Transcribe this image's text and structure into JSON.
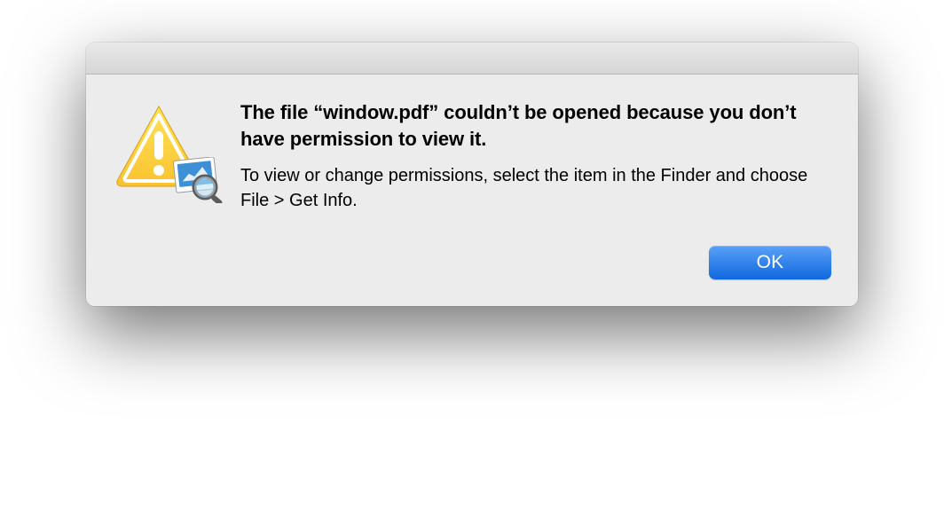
{
  "dialog": {
    "heading": "The file “window.pdf” couldn’t be opened because you don’t have permission to view it.",
    "description": "To view or change permissions, select the item in the Finder and choose File > Get Info.",
    "ok_label": "OK"
  },
  "icons": {
    "alert": "warning-triangle",
    "app_badge": "preview-app"
  }
}
